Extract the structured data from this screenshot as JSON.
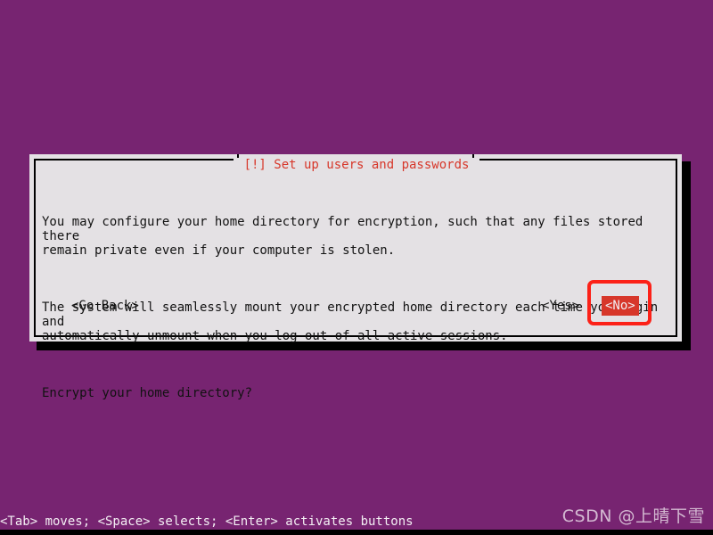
{
  "screen": {
    "background_color": "#772471",
    "bottom_strip_color": "#000000"
  },
  "dialog": {
    "title": "[!] Set up users and passwords",
    "title_color": "#d7372a",
    "background_color": "#e4e1e4",
    "border_color": "#000000",
    "paragraphs": [
      "You may configure your home directory for encryption, such that any files stored there\nremain private even if your computer is stolen.",
      "The system will seamlessly mount your encrypted home directory each time you login and\nautomatically unmount when you log out of all active sessions.",
      "Encrypt your home directory?"
    ],
    "buttons": {
      "go_back": "<Go Back>",
      "yes": "<Yes>",
      "no": "<No>",
      "selected": "<No>",
      "selected_background": "#d7372a",
      "selected_text_color": "#f2eef2"
    }
  },
  "annotation": {
    "target": "<No>",
    "shape": "rectangle",
    "color": "#fc2118",
    "border_width_px": 4
  },
  "status_bar": {
    "help_text": "<Tab> moves; <Space> selects; <Enter> activates buttons",
    "text_color": "#f3eef3"
  },
  "watermark": {
    "text": "CSDN @上晴下雪"
  }
}
